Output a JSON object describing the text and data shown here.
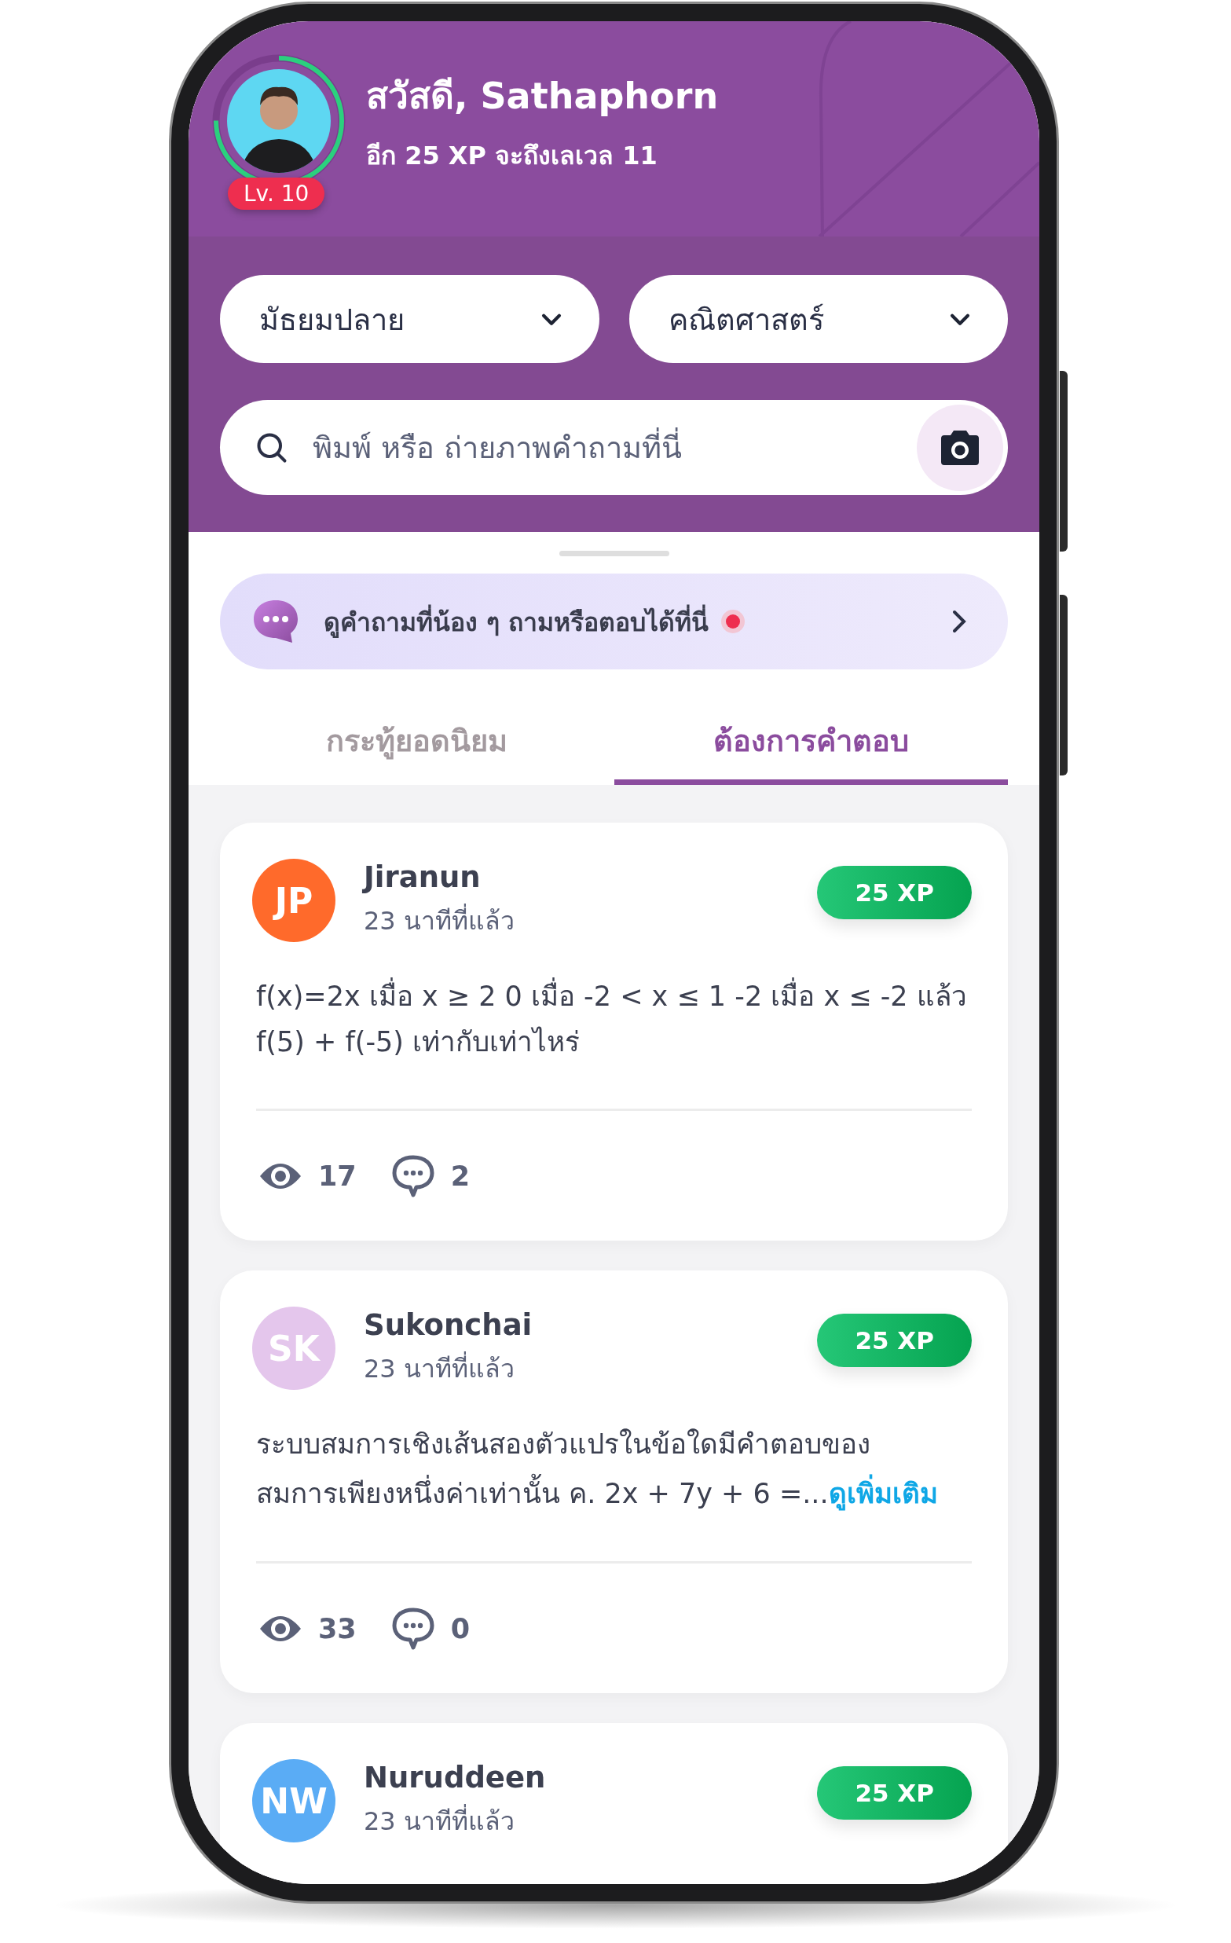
{
  "header": {
    "greeting": "สวัสดี, Sathaphorn",
    "subtitle": "อีก 25 XP จะถึงเลเวล 11",
    "level_badge": "Lv. 10"
  },
  "filters": [
    {
      "label": "มัธยมปลาย"
    },
    {
      "label": "คณิตศาสตร์"
    }
  ],
  "search": {
    "placeholder": "พิมพ์ หรือ ถ่ายภาพคำถามที่นี่"
  },
  "banner": {
    "text": "ดูคำถามที่น้อง ๆ ถามหรือตอบได้ที่นี่",
    "unread": true
  },
  "tabs": [
    {
      "label": "กระทู้ยอดนิยม",
      "selected": false
    },
    {
      "label": "ต้องการคำตอบ",
      "selected": true
    }
  ],
  "posts": [
    {
      "initials": "JP",
      "color": "#ff6a2b",
      "name": "Jiranun",
      "time": "23 นาทีที่แล้ว",
      "xp": "25 XP",
      "question": "f(x)=2x เมื่อ x ≥ 2 0 เมื่อ -2 < x ≤ 1  -2  เมื่อ x ≤ -2 แล้ว\nf(5) + f(-5) เท่ากับเท่าไหร่",
      "views": "17",
      "comments": "2"
    },
    {
      "initials": "SK",
      "color": "#e4c6ec",
      "name": "Sukonchai",
      "time": "23 นาทีที่แล้ว",
      "xp": "25 XP",
      "question": "ระบบสมการเชิงเส้นสองตัวแปรในข้อใดมีคำตอบของ\nสมการเพียงหนึ่งค่าเท่านั้น ค. 2x + 7y + 6 =...",
      "more_link": "ดูเพิ่มเติม",
      "views": "33",
      "comments": "0"
    },
    {
      "initials": "NW",
      "color": "#5aacf5",
      "name": "Nuruddeen",
      "time": "23 นาทีที่แล้ว",
      "xp": "25 XP"
    }
  ]
}
